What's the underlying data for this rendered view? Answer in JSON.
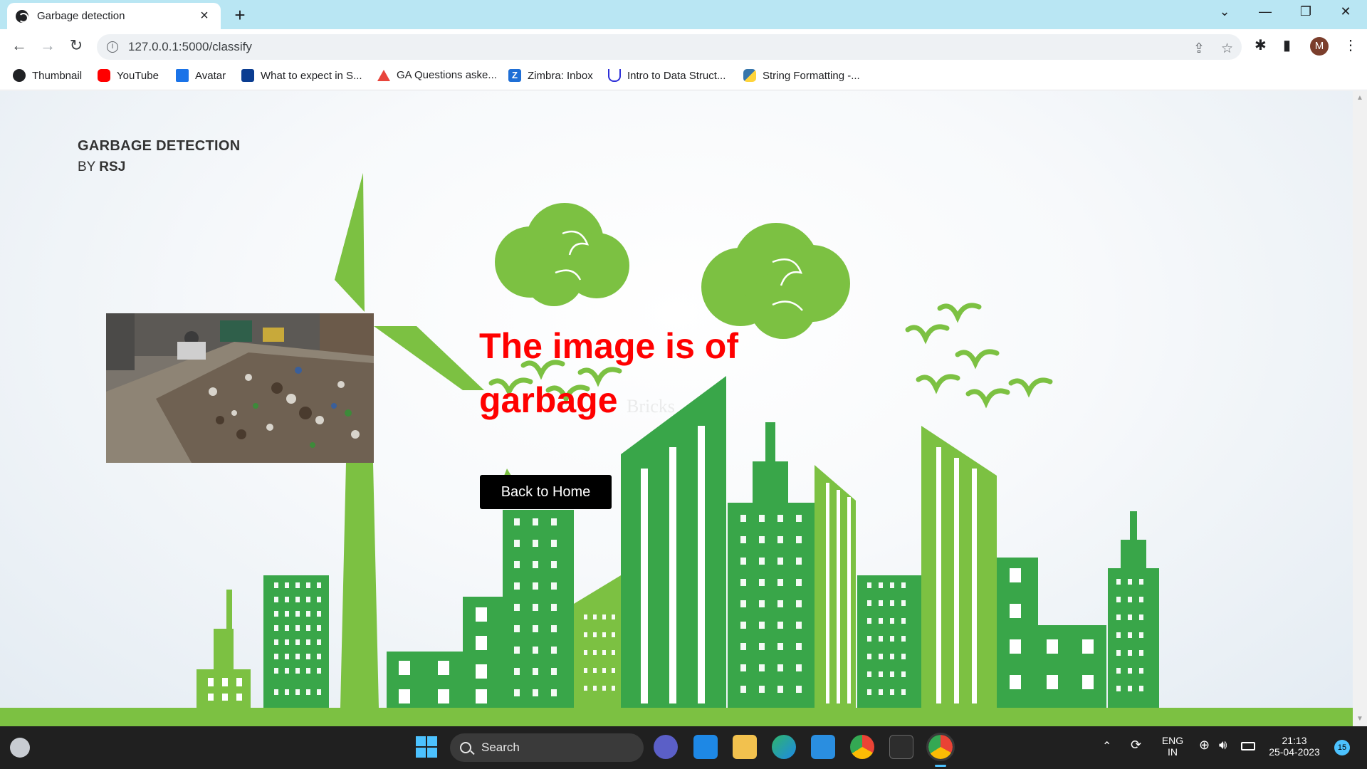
{
  "browser": {
    "tab_title": "Garbage detection",
    "tab_close": "×",
    "new_tab": "+",
    "url": "127.0.0.1:5000/classify",
    "profile_initial": "M",
    "bookmarks": [
      {
        "label": "Thumbnail",
        "color": "#202124"
      },
      {
        "label": "YouTube",
        "color": "#ff0000"
      },
      {
        "label": "Avatar",
        "color": "#1a73e8"
      },
      {
        "label": "What to expect in S...",
        "color": "#0b3d91"
      },
      {
        "label": "GA Questions aske...",
        "color": "#e8453c"
      },
      {
        "label": "Zimbra: Inbox",
        "color": "#1f6fd6"
      },
      {
        "label": "Intro to Data Struct...",
        "color": "#2d2fd8"
      },
      {
        "label": "String Formatting -...",
        "color": "#3776ab"
      }
    ]
  },
  "page": {
    "brand_title": "GARBAGE DETECTION",
    "brand_by": "BY",
    "brand_author": "RSJ",
    "result_text": "The image is of garbage",
    "watermark": "Bricks",
    "back_button": "Back to Home",
    "theme_green": "#7cc142",
    "building_green": "#39a649",
    "result_color": "#ff0000"
  },
  "taskbar": {
    "search_label": "Search",
    "lang_top": "ENG",
    "lang_bottom": "IN",
    "time": "21:13",
    "date": "25-04-2023",
    "notification_count": "15"
  }
}
